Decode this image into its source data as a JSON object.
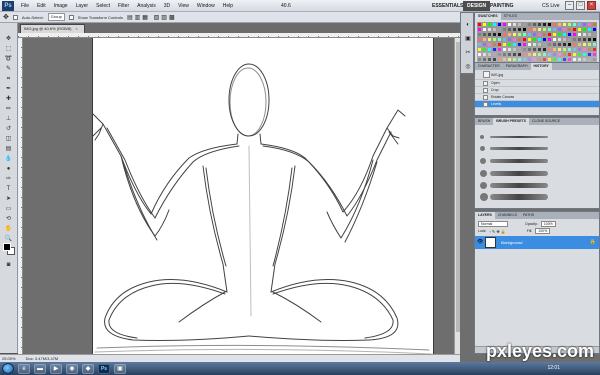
{
  "app": {
    "logo_text": "Ps",
    "menus": [
      "File",
      "Edit",
      "Image",
      "Layer",
      "Select",
      "Filter",
      "Analysis",
      "3D",
      "View",
      "Window",
      "Help"
    ],
    "zoom": "40.6",
    "workspaces": [
      "ESSENTIALS",
      "DESIGN",
      "PAINTING"
    ],
    "active_workspace": "DESIGN",
    "cs_live": "CS Live",
    "window_controls": [
      "–",
      "□",
      "×"
    ]
  },
  "options_bar": {
    "auto_select_label": "Auto-Select:",
    "auto_select_value": "Group",
    "show_transform_label": "Show Transform Controls"
  },
  "document": {
    "tab_title": "IMG.jpg @ 40.6% (RGB/8)",
    "zoom_status": "25.00%",
    "doc_size": "Doc: 3.47M/3.47M"
  },
  "panels": {
    "swatches": {
      "tabs": [
        "SWATCHES",
        "STYLES"
      ]
    },
    "history": {
      "tabs": [
        "CHARACTER",
        "PARAGRAPH",
        "HISTORY"
      ],
      "items": [
        "IMG.jpg",
        "Open",
        "Crop",
        "Rotate Canvas",
        "Levels"
      ]
    },
    "brushes": {
      "tabs": [
        "BRUSH",
        "BRUSH PRESETS",
        "CLONE SOURCE"
      ]
    },
    "layers": {
      "tabs": [
        "LAYERS",
        "CHANNELS",
        "PATHS"
      ],
      "blend_mode": "Normal",
      "opacity_label": "Opacity:",
      "opacity": "100%",
      "lock_label": "Lock:",
      "fill_label": "Fill:",
      "fill": "100%",
      "layer_name": "Background"
    }
  },
  "taskbar": {
    "clock": "12:01"
  },
  "watermark": "pxleyes.com",
  "colors": {
    "accent": "#3a8de0",
    "swatches": [
      "#ff0000",
      "#ffff00",
      "#00ff00",
      "#00ffff",
      "#0000ff",
      "#ff00ff",
      "#ffffff",
      "#e0e0e0",
      "#c0c0c0",
      "#a0a0a0",
      "#808080",
      "#606060",
      "#404040",
      "#202020",
      "#000000",
      "#ff6b6b",
      "#ffb36b",
      "#fff06b",
      "#a8ff6b",
      "#6bffd2",
      "#6bb8ff",
      "#8a6bff",
      "#ff6bd6",
      "#c08040"
    ]
  }
}
